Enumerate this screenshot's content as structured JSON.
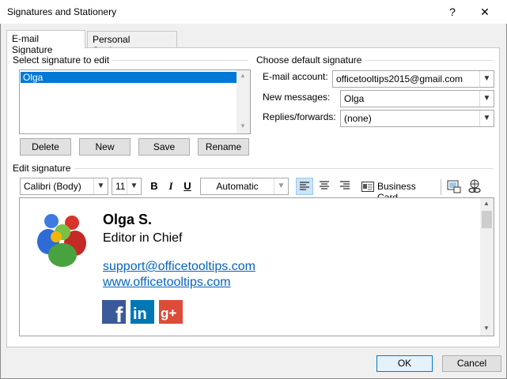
{
  "window": {
    "title": "Signatures and Stationery",
    "help": "?",
    "close": "✕"
  },
  "tabs": [
    {
      "label": "E-mail Signature",
      "underline": "E"
    },
    {
      "label": "Personal Stationery",
      "underline": "P"
    }
  ],
  "select_signature": {
    "label": "Select signature to edit",
    "items": [
      "Olga"
    ],
    "selected": "Olga"
  },
  "sig_buttons": {
    "delete": "Delete",
    "new": "New",
    "save": "Save",
    "rename": "Rename"
  },
  "default_signature": {
    "label": "Choose default signature",
    "email_account_label": "E-mail account:",
    "email_account_value": "officetooltips2015@gmail.com",
    "new_messages_label": "New messages:",
    "new_messages_value": "Olga",
    "replies_label": "Replies/forwards:",
    "replies_value": "(none)"
  },
  "edit_signature": {
    "label": "Edit signature",
    "font": "Calibri (Body)",
    "size": "11",
    "bold": "B",
    "italic": "I",
    "underline": "U",
    "color": "Automatic",
    "business_card": "Business Card"
  },
  "signature_content": {
    "name": "Olga S.",
    "role": "Editor in Chief",
    "email": "support@officetooltips.com",
    "website": "www.officetooltips.com",
    "social": [
      "facebook",
      "linkedin",
      "google-plus"
    ]
  },
  "footer": {
    "ok": "OK",
    "cancel": "Cancel"
  },
  "colors": {
    "selection": "#0078d7",
    "link": "#0563c1",
    "facebook": "#3b5998",
    "linkedin": "#0077b5",
    "gplus": "#dd4b39"
  }
}
